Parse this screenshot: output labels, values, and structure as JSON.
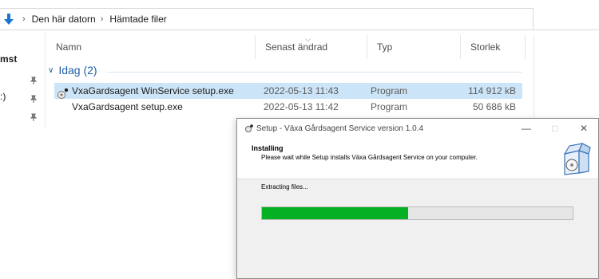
{
  "explorer": {
    "breadcrumb": [
      "Den här datorn",
      "Hämtade filer"
    ],
    "nav_labels": [
      "mst",
      ":)"
    ],
    "columns": [
      "Namn",
      "Senast ändrad",
      "Typ",
      "Storlek"
    ],
    "group": "Idag (2)",
    "files": [
      {
        "name": "VxaGardsagent WinService setup.exe",
        "date": "2022-05-13 11:43",
        "type": "Program",
        "size": "114 912 kB",
        "selected": true
      },
      {
        "name": "VxaGardsagent setup.exe",
        "date": "2022-05-13 11:42",
        "type": "Program",
        "size": "50 686 kB",
        "selected": false
      }
    ]
  },
  "setup": {
    "title": "Setup - Växa Gårdsagent Service version 1.0.4",
    "heading": "Installing",
    "subheading": "Please wait while Setup installs Växa Gårdsagent Service on your computer.",
    "status": "Extracting files...",
    "progress": 0.47
  },
  "colors": {
    "selection": "#cce4f7",
    "group_header": "#1e5fa8",
    "progress_fill": "#06b025",
    "progress_track": "#e6e6e6",
    "download_arrow": "#1c75d2"
  },
  "icons": {
    "download": "arrow-down-icon",
    "chevron": "chevron-right-icon",
    "pin": "pin-icon",
    "setup": "installer-box-icon",
    "exe": "exe-file-icon"
  }
}
